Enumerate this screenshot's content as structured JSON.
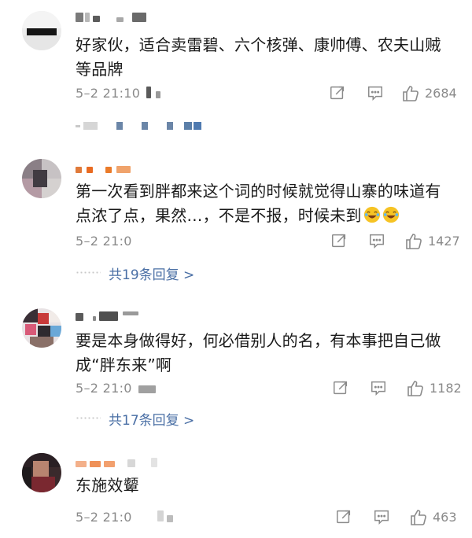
{
  "comments": [
    {
      "text": "好家伙，适合卖雷碧、六个核弹、康帅傅、农夫山贼等品牌",
      "time": "5–2 21:10",
      "likes": "2684"
    },
    {
      "text": "第一次看到胖都来这个词的时候就觉得山寨的味道有点浓了点，果然…，不是不报，时候未到",
      "emoji": "laughing-crying-emoji",
      "time": "5–2 21:0",
      "likes": "1427",
      "replies_label": "共19条回复 >"
    },
    {
      "text": "要是本身做得好，何必借别人的名，有本事把自己做成“胖东来”啊",
      "time": "5–2 21:0",
      "likes": "1182",
      "replies_label": "共17条回复 >"
    },
    {
      "text": "东施效颦",
      "time": "5–2 21:0",
      "likes": "463"
    }
  ],
  "icons": {
    "share": "share-icon",
    "comment": "comment-icon",
    "like": "like-icon"
  },
  "colors": {
    "text": "#1a1a1a",
    "meta": "#8a8a8a",
    "link": "#4a6fa5",
    "background": "#ffffff"
  }
}
